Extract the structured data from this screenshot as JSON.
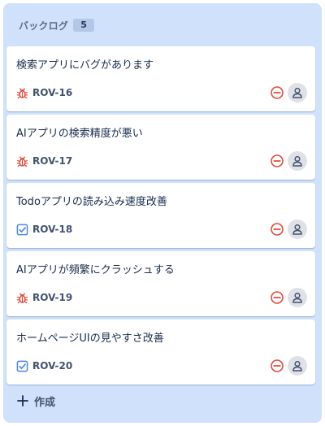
{
  "column": {
    "title": "バックログ",
    "count": "5"
  },
  "cards": [
    {
      "title": "検索アプリにバグがあります",
      "key": "ROV-16",
      "type_icon": "bug-icon",
      "priority_icon": "priority-blocker-icon"
    },
    {
      "title": "AIアプリの検索精度が悪い",
      "key": "ROV-17",
      "type_icon": "bug-icon",
      "priority_icon": "priority-blocker-icon"
    },
    {
      "title": "Todoアプリの読み込み速度改善",
      "key": "ROV-18",
      "type_icon": "task-checkbox-icon",
      "priority_icon": "priority-blocker-icon"
    },
    {
      "title": "AIアプリが頻繁にクラッシュする",
      "key": "ROV-19",
      "type_icon": "bug-icon",
      "priority_icon": "priority-blocker-icon"
    },
    {
      "title": "ホームページUIの見やすさ改善",
      "key": "ROV-20",
      "type_icon": "task-checkbox-icon",
      "priority_icon": "priority-blocker-icon"
    }
  ],
  "create": {
    "label": "作成",
    "icon": "plus-icon"
  },
  "colors": {
    "column_bg": "#cfe1fb",
    "bug": "#e5493a",
    "task": "#4a86e8",
    "priority": "#e5493a",
    "avatar_bg": "#dfe1e6"
  }
}
